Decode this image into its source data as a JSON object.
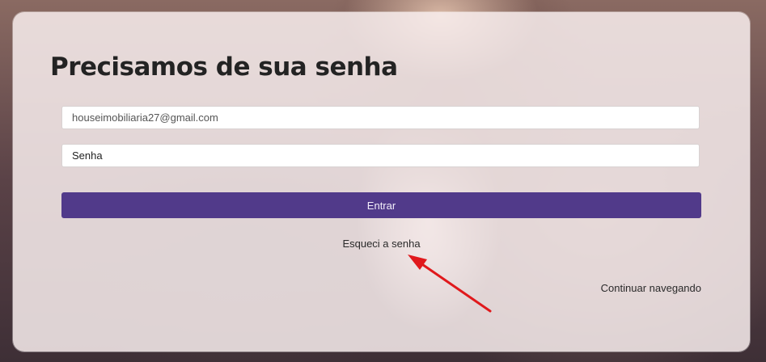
{
  "login": {
    "title": "Precisamos de sua senha",
    "email_value": "houseimobiliaria27@gmail.com",
    "password_placeholder": "Senha",
    "submit_label": "Entrar",
    "forgot_label": "Esqueci a senha",
    "continue_label": "Continuar navegando"
  },
  "colors": {
    "primary_button": "#513a8a",
    "annotation_arrow": "#e0191c"
  },
  "annotation": {
    "icon": "red-arrow-icon"
  }
}
